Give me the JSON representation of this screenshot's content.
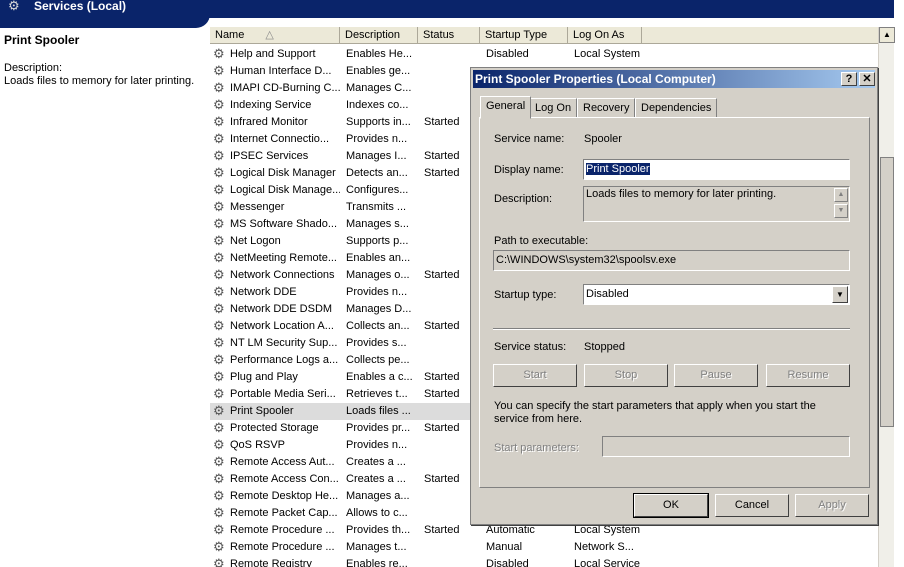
{
  "window": {
    "title": "Services (Local)",
    "icon": "gears-icon"
  },
  "left_panel": {
    "service_name": "Print Spooler",
    "description_label": "Description:",
    "description_text": "Loads files to memory for later printing."
  },
  "list": {
    "columns": [
      "Name",
      "Description",
      "Status",
      "Startup Type",
      "Log On As"
    ],
    "sort_indicator": "△",
    "rows": [
      {
        "name": "Help and Support",
        "description": "Enables He...",
        "status": "",
        "startup": "Disabled",
        "logon": "Local System"
      },
      {
        "name": "Human Interface D...",
        "description": "Enables ge...",
        "status": "",
        "startup": "",
        "logon": ""
      },
      {
        "name": "IMAPI CD-Burning C...",
        "description": "Manages C...",
        "status": "",
        "startup": "",
        "logon": ""
      },
      {
        "name": "Indexing Service",
        "description": "Indexes co...",
        "status": "",
        "startup": "",
        "logon": ""
      },
      {
        "name": "Infrared Monitor",
        "description": "Supports in...",
        "status": "Started",
        "startup": "",
        "logon": ""
      },
      {
        "name": "Internet Connectio...",
        "description": "Provides n...",
        "status": "",
        "startup": "",
        "logon": ""
      },
      {
        "name": "IPSEC Services",
        "description": "Manages I...",
        "status": "Started",
        "startup": "",
        "logon": ""
      },
      {
        "name": "Logical Disk Manager",
        "description": "Detects an...",
        "status": "Started",
        "startup": "",
        "logon": ""
      },
      {
        "name": "Logical Disk Manage...",
        "description": "Configures...",
        "status": "",
        "startup": "",
        "logon": ""
      },
      {
        "name": "Messenger",
        "description": "Transmits ...",
        "status": "",
        "startup": "",
        "logon": ""
      },
      {
        "name": "MS Software Shado...",
        "description": "Manages s...",
        "status": "",
        "startup": "",
        "logon": ""
      },
      {
        "name": "Net Logon",
        "description": "Supports p...",
        "status": "",
        "startup": "",
        "logon": ""
      },
      {
        "name": "NetMeeting Remote...",
        "description": "Enables an...",
        "status": "",
        "startup": "",
        "logon": ""
      },
      {
        "name": "Network Connections",
        "description": "Manages o...",
        "status": "Started",
        "startup": "",
        "logon": ""
      },
      {
        "name": "Network DDE",
        "description": "Provides n...",
        "status": "",
        "startup": "",
        "logon": ""
      },
      {
        "name": "Network DDE DSDM",
        "description": "Manages D...",
        "status": "",
        "startup": "",
        "logon": ""
      },
      {
        "name": "Network Location A...",
        "description": "Collects an...",
        "status": "Started",
        "startup": "",
        "logon": ""
      },
      {
        "name": "NT LM Security Sup...",
        "description": "Provides s...",
        "status": "",
        "startup": "",
        "logon": ""
      },
      {
        "name": "Performance Logs a...",
        "description": "Collects pe...",
        "status": "",
        "startup": "",
        "logon": ""
      },
      {
        "name": "Plug and Play",
        "description": "Enables a c...",
        "status": "Started",
        "startup": "",
        "logon": ""
      },
      {
        "name": "Portable Media Seri...",
        "description": "Retrieves t...",
        "status": "Started",
        "startup": "",
        "logon": ""
      },
      {
        "name": "Print Spooler",
        "description": "Loads files ...",
        "status": "",
        "startup": "",
        "logon": "",
        "selected": true
      },
      {
        "name": "Protected Storage",
        "description": "Provides pr...",
        "status": "Started",
        "startup": "",
        "logon": ""
      },
      {
        "name": "QoS RSVP",
        "description": "Provides n...",
        "status": "",
        "startup": "",
        "logon": ""
      },
      {
        "name": "Remote Access Aut...",
        "description": "Creates a ...",
        "status": "",
        "startup": "",
        "logon": ""
      },
      {
        "name": "Remote Access Con...",
        "description": "Creates a ...",
        "status": "Started",
        "startup": "",
        "logon": ""
      },
      {
        "name": "Remote Desktop He...",
        "description": "Manages a...",
        "status": "",
        "startup": "",
        "logon": ""
      },
      {
        "name": "Remote Packet Cap...",
        "description": "Allows to c...",
        "status": "",
        "startup": "",
        "logon": ""
      },
      {
        "name": "Remote Procedure ...",
        "description": "Provides th...",
        "status": "Started",
        "startup": "Automatic",
        "logon": "Local System"
      },
      {
        "name": "Remote Procedure ...",
        "description": "Manages t...",
        "status": "",
        "startup": "Manual",
        "logon": "Network S..."
      },
      {
        "name": "Remote Registry",
        "description": "Enables re...",
        "status": "",
        "startup": "Disabled",
        "logon": "Local Service"
      }
    ]
  },
  "dialog": {
    "title": "Print Spooler Properties (Local Computer)",
    "help_btn": "?",
    "close_btn": "✕",
    "tabs": [
      "General",
      "Log On",
      "Recovery",
      "Dependencies"
    ],
    "service_name_label": "Service name:",
    "service_name_value": "Spooler",
    "display_name_label": "Display name:",
    "display_name_value": "Print Spooler",
    "description_label": "Description:",
    "description_value": "Loads files to memory for later printing.",
    "path_label": "Path to executable:",
    "path_value": "C:\\WINDOWS\\system32\\spoolsv.exe",
    "startup_type_label": "Startup type:",
    "startup_type_value": "Disabled",
    "status_label": "Service status:",
    "status_value": "Stopped",
    "buttons": {
      "start": "Start",
      "stop": "Stop",
      "pause": "Pause",
      "resume": "Resume"
    },
    "params_hint": "You can specify the start parameters that apply when you start the service from here.",
    "params_label": "Start parameters:",
    "ok": "OK",
    "cancel": "Cancel",
    "apply": "Apply"
  }
}
